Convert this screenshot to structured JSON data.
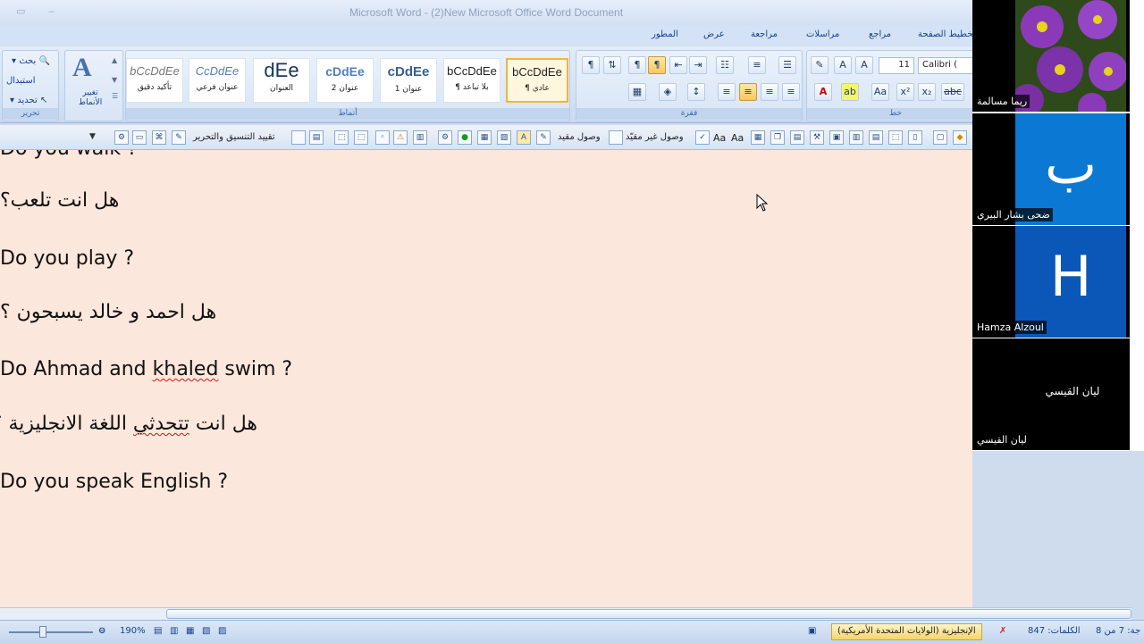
{
  "window": {
    "title": "Microsoft Word - (2)New Microsoft Office Word Document"
  },
  "tabs": [
    "المطور",
    "عرض",
    "مراجعة",
    "مراسلات",
    "مراجع",
    "تخطيط الصفحة"
  ],
  "ribbon": {
    "edit_group": {
      "label": "تحرير",
      "find": "بحث",
      "replace": "استبدال",
      "select": "تحديد"
    },
    "change_styles": "تغيير الأنماط",
    "styles_group": {
      "label": "أنماط",
      "styles": [
        {
          "sample": "bCcDdEe",
          "name": "تأكيد دقيق"
        },
        {
          "sample": "CcDdEe",
          "name": "عنوان فرعي"
        },
        {
          "sample": "dEe",
          "name": "العنوان"
        },
        {
          "sample": "cDdEe",
          "name": "عنوان 2"
        },
        {
          "sample": "cDdEe",
          "name": "عنوان 1"
        },
        {
          "sample": "bCcDdEe",
          "name": "¶ بلا تباعد"
        },
        {
          "sample": "bCcDdEe",
          "name": "¶ عادي"
        }
      ]
    },
    "paragraph_group": {
      "label": "فقرة"
    },
    "font_group": {
      "label": "خط",
      "font_name": "Calibri (",
      "font_size": "11"
    }
  },
  "toolbar2": {
    "restrict_editing": "تقييد التنسيق والتحرير",
    "full_access": "وصول مقيد",
    "unrestricted_access": "وصول غير مقيّد"
  },
  "document": {
    "lines": [
      "Do you walk ?",
      "هل انت تلعب؟",
      "Do you play ?",
      "هل احمد و خالد يسبحون ؟",
      "Do Ahmad and khaled swim ?",
      "هل انت تتحدثي اللغة الانجليزية ؟",
      "Do you speak English ?"
    ],
    "line5_parts": {
      "before": "Do Ahmad and ",
      "squiggle": "khaled",
      "after": " swim ?"
    },
    "line6_parts": {
      "before": "هل انت ",
      "squiggle": "تتحدثي",
      "after": " اللغة الانجليزية ؟"
    }
  },
  "status": {
    "page": "جة: 7 من 8",
    "words": "الكلمات: 847",
    "language": "الإنجليزية (الولايات المتحدة الأمريكية)",
    "zoom": "190%"
  },
  "participants": [
    {
      "name": "ريما مسالمة",
      "type": "photo"
    },
    {
      "name": "ضحى بشار البيري",
      "type": "letter",
      "letter": "ب",
      "color": "#0b78d4"
    },
    {
      "name": "Hamza Alzoul",
      "type": "letter",
      "letter": "H",
      "color": "#0b57b8"
    },
    {
      "name": "ليان القيسي",
      "type": "name",
      "center_name": "ليان القيسي"
    }
  ]
}
